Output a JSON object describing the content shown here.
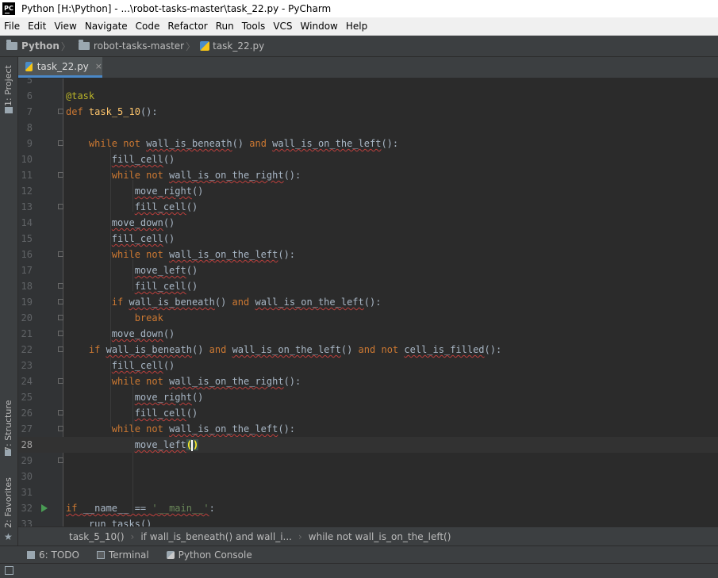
{
  "window": {
    "title": "Python [H:\\Python] - ...\\robot-tasks-master\\task_22.py - PyCharm",
    "logo": "PC"
  },
  "menu": [
    "File",
    "Edit",
    "View",
    "Navigate",
    "Code",
    "Refactor",
    "Run",
    "Tools",
    "VCS",
    "Window",
    "Help"
  ],
  "nav": {
    "project": "Python",
    "folder": "robot-tasks-master",
    "file": "task_22.py"
  },
  "side_tabs": {
    "project": "1: Project",
    "structure": "7: Structure",
    "favorites": "2: Favorites"
  },
  "editor_tab": {
    "label": "task_22.py",
    "close": "×"
  },
  "code": {
    "line_numbers": [
      "5",
      "6",
      "7",
      "8",
      "9",
      "10",
      "11",
      "12",
      "13",
      "14",
      "15",
      "16",
      "17",
      "18",
      "19",
      "20",
      "21",
      "22",
      "23",
      "24",
      "25",
      "26",
      "27",
      "28",
      "29",
      "30",
      "31",
      "32",
      "33"
    ],
    "decorator": "@task",
    "def_kw": "def",
    "func_name": "task_5_10",
    "def_tail": "():",
    "while": "while",
    "not": "not",
    "and": "and",
    "if": "if",
    "break": "break",
    "wall_is_beneath": "wall_is_beneath",
    "wall_is_on_the_left": "wall_is_on_the_left",
    "wall_is_on_the_right": "wall_is_on_the_right",
    "cell_is_filled": "cell_is_filled",
    "fill_cell": "fill_cell",
    "move_right": "move_right",
    "move_left": "move_left",
    "move_down": "move_down",
    "call": "()",
    "call_colon": "():",
    "open": "(",
    "close": ")",
    "name_var": "__name__",
    "eq": " == ",
    "main_str": "'__main__'",
    "colon": ":",
    "run_tasks": "run_tasks"
  },
  "breadcrumbs": [
    "task_5_10()",
    "if wall_is_beneath() and wall_i...",
    "while not wall_is_on_the_left()"
  ],
  "bottom_tabs": [
    {
      "label": "6: TODO"
    },
    {
      "label": "Terminal"
    },
    {
      "label": "Python Console"
    }
  ],
  "icons": {
    "folder": "folder-icon",
    "python_file": "python-file-icon",
    "run": "run-gutter-icon"
  },
  "colors": {
    "keyword": "#cc7832",
    "function": "#ffc66d",
    "decorator": "#bbb529",
    "string": "#6a8759",
    "text": "#a9b7c6",
    "background": "#2b2b2b"
  }
}
